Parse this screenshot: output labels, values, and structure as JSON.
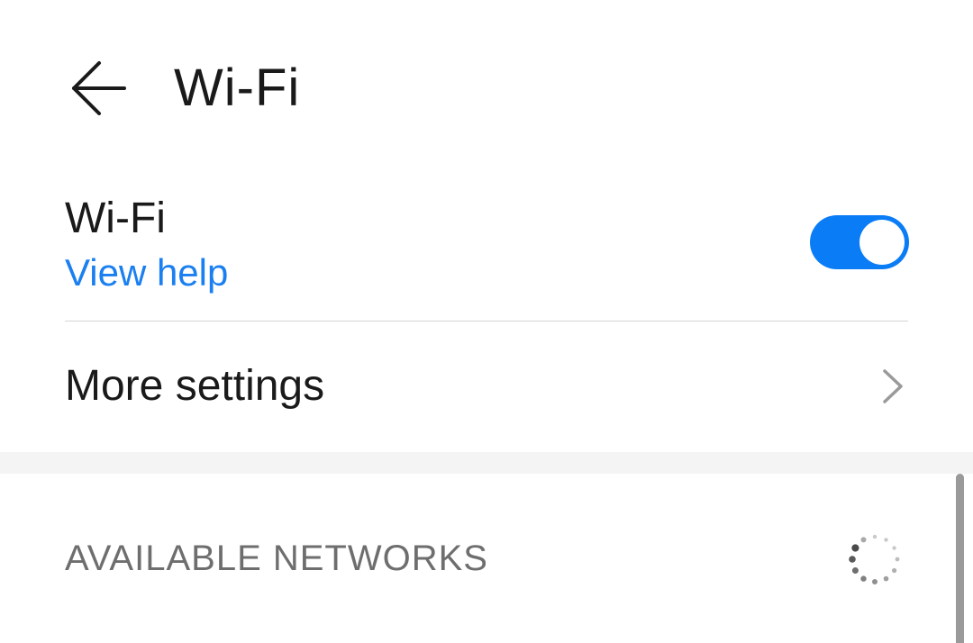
{
  "header": {
    "title": "Wi-Fi",
    "back_icon": "arrow-left-icon"
  },
  "wifi_setting": {
    "label": "Wi-Fi",
    "help_link": "View help",
    "enabled": true,
    "toggle_color": "#0a7cf6"
  },
  "more_settings": {
    "label": "More settings",
    "icon": "chevron-right-icon"
  },
  "networks": {
    "section_title": "AVAILABLE NETWORKS",
    "scanning_icon": "loading-spinner-icon",
    "items": [
      {
        "name": ""
      }
    ]
  },
  "colors": {
    "accent": "#0a7cf6",
    "link": "#1a7ff0",
    "section_label": "#6e6e6e"
  }
}
